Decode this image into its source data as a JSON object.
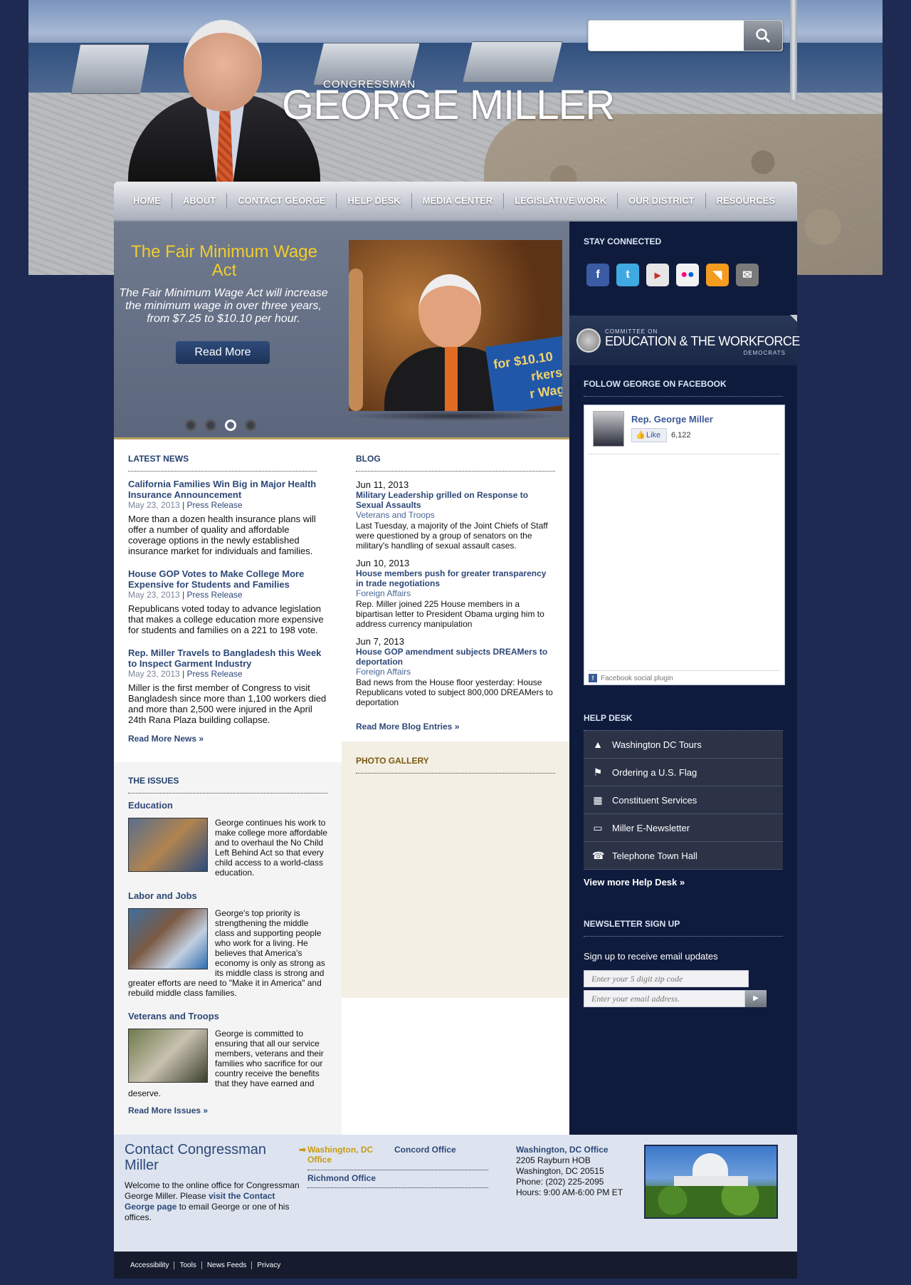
{
  "header": {
    "title_small": "CONGRESSMAN",
    "title_big": "GEORGE MILLER",
    "search": {
      "placeholder": "",
      "value": ""
    }
  },
  "nav": [
    "HOME",
    "ABOUT",
    "CONTACT GEORGE",
    "HELP DESK",
    "MEDIA CENTER",
    "LEGISLATIVE WORK",
    "OUR DISTRICT",
    "RESOURCES"
  ],
  "feature": {
    "title": "The Fair Minimum Wage Act",
    "subtitle": "The Fair Minimum Wage Act will increase the minimum wage in over three years, from $7.25 to $10.10 per hour.",
    "button": "Read More",
    "photo_sign": "for $10.10",
    "photo_sign2": "rkers",
    "photo_sign3": "r Wag",
    "slides": 4,
    "active_slide": 3
  },
  "news": {
    "heading": "LATEST NEWS",
    "items": [
      {
        "title": "California Families Win Big in Major Health Insurance Announcement",
        "date": "May 23, 2013",
        "type": "Press Release",
        "text": "More than a dozen health insurance plans will offer a number of quality and affordable coverage options in the newly established insurance market for individuals and families."
      },
      {
        "title": "House GOP Votes to Make College More Expensive for Students and Families",
        "date": "May 23, 2013",
        "type": "Press Release",
        "text": "Republicans voted today to advance legislation that makes a college education more expensive for students and families on a 221 to 198 vote."
      },
      {
        "title": "Rep. Miller Travels to Bangladesh this Week to Inspect Garment Industry",
        "date": "May 23, 2013",
        "type": "Press Release",
        "text": "Miller is the first member of Congress to visit Bangladesh since more than 1,100 workers died and more than 2,500 were injured in the April 24th Rana Plaza building collapse."
      }
    ],
    "more": "Read More News »"
  },
  "blog": {
    "heading": "BLOG",
    "items": [
      {
        "date": "Jun 11, 2013",
        "title": "Military Leadership grilled on Response to Sexual Assaults",
        "category": "Veterans and Troops",
        "text": "Last Tuesday, a majority of the Joint Chiefs of Staff were questioned by a group of senators on the military's handling of sexual assault cases."
      },
      {
        "date": "Jun 10, 2013",
        "title": "House members push for greater transparency in trade negotiations",
        "category": "Foreign Affairs",
        "text": "Rep. Miller joined 225 House members in a bipartisan letter to President Obama urging him to address currency manipulation"
      },
      {
        "date": "Jun 7, 2013",
        "title": "House GOP amendment subjects DREAMers to deportation",
        "category": "Foreign Affairs",
        "text": "Bad news from the House floor yesterday: House Republicans voted to subject 800,000 DREAMers to deportation"
      }
    ],
    "more": "Read More Blog Entries »"
  },
  "photo_gallery": {
    "heading": "PHOTO GALLERY"
  },
  "issues": {
    "heading": "THE ISSUES",
    "items": [
      {
        "title": "Education",
        "text": "George continues his work to make college more affordable and to overhaul the No Child Left Behind Act so that every child access to a world-class education."
      },
      {
        "title": "Labor and Jobs",
        "text": "George's top priority is strengthening the middle class and supporting people who work for a living. He believes that America's economy is only as strong as its middle class is strong and greater efforts are need to \"Make it in America\" and rebuild middle class families."
      },
      {
        "title": "Veterans and Troops",
        "text": "George is committed to ensuring that all our service members, veterans and their families who sacrifice for our country receive the benefits that they have earned and deserve."
      }
    ],
    "more": "Read More Issues »"
  },
  "sidebar": {
    "stay_connected": "STAY CONNECTED",
    "social": [
      {
        "icon": "facebook-icon",
        "glyph": "f",
        "color": "#3b5ba5"
      },
      {
        "icon": "twitter-icon",
        "glyph": "t",
        "color": "#3fa9e1"
      },
      {
        "icon": "youtube-icon",
        "glyph": "▶",
        "color": "#e6e6e6"
      },
      {
        "icon": "flickr-icon",
        "glyph": "●",
        "color": "#f2f2f2"
      },
      {
        "icon": "rss-icon",
        "glyph": "◥",
        "color": "#f39c1e"
      },
      {
        "icon": "email-icon",
        "glyph": "✉",
        "color": "#7a7a7a"
      }
    ],
    "committee": {
      "small": "COMMITTEE ON",
      "main": "EDUCATION & THE WORKFORCE",
      "sub": "DEMOCRATS"
    },
    "follow": "FOLLOW GEORGE ON FACEBOOK",
    "facebook": {
      "name": "Rep. George Miller",
      "like": "Like",
      "count": "6,122",
      "plugin": "Facebook social plugin"
    },
    "helpdesk": {
      "heading": "HELP DESK",
      "items": [
        {
          "icon": "monument-icon",
          "glyph": "▲",
          "label": "Washington DC Tours"
        },
        {
          "icon": "flag-icon",
          "glyph": "⚑",
          "label": "Ordering a U.S. Flag"
        },
        {
          "icon": "building-icon",
          "glyph": "▦",
          "label": "Constituent Services"
        },
        {
          "icon": "computer-icon",
          "glyph": "▭",
          "label": "Miller E-Newsletter"
        },
        {
          "icon": "telephone-icon",
          "glyph": "☎",
          "label": "Telephone Town Hall"
        }
      ],
      "more": "View more Help Desk »"
    },
    "newsletter": {
      "heading": "NEWSLETTER SIGN UP",
      "text": "Sign up to receive email updates",
      "zip_placeholder": "Enter your 5 digit zip code",
      "email_placeholder": "Enter your email address."
    }
  },
  "footer": {
    "heading": "Contact Congressman Miller",
    "intro_pre": "Welcome to the online office for Congressman George Miller. Please ",
    "intro_link": "visit the Contact George page",
    "intro_post": " to email George or one of his offices.",
    "offices": [
      {
        "label": "Washington, DC Office",
        "active": true
      },
      {
        "label": "Concord Office",
        "active": false
      },
      {
        "label": "Richmond Office",
        "active": false
      }
    ],
    "address": {
      "title": "Washington, DC Office",
      "line1": "2205 Rayburn HOB",
      "line2": "Washington, DC 20515",
      "phone": "Phone: (202) 225-2095",
      "hours": "Hours: 9:00 AM-6:00 PM ET"
    },
    "links": [
      "Accessibility",
      "Tools",
      "News Feeds",
      "Privacy"
    ]
  }
}
